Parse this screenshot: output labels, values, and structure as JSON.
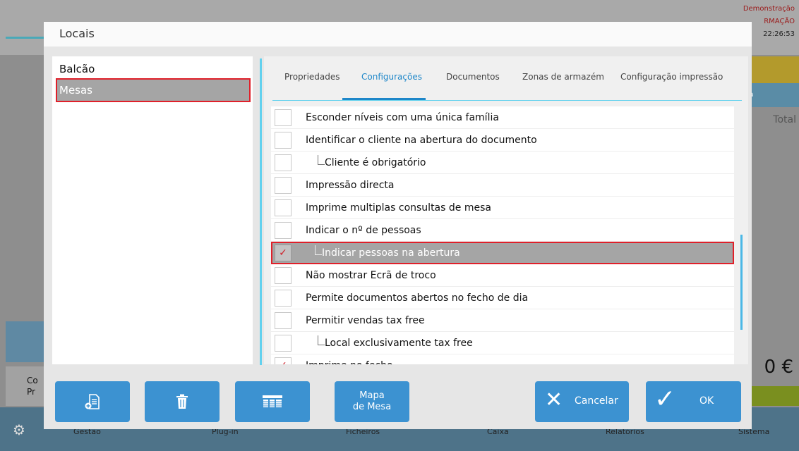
{
  "background": {
    "status": "Demonstração",
    "mode": "RMAÇÃO",
    "time": "22:26:53",
    "side_tab": "sa",
    "total_label": "Total",
    "amount": "0 €",
    "left_button": "Co\nPr",
    "bottom_labels": [
      "Gestão",
      "Plug-in",
      "Ficheiros",
      "Caixa",
      "Relatórios",
      "Sistema"
    ]
  },
  "dialog": {
    "title": "Locais",
    "locations": [
      {
        "label": "Balcão",
        "selected": false
      },
      {
        "label": "Mesas",
        "selected": true
      }
    ],
    "tabs": [
      {
        "label": "Propriedades",
        "active": false
      },
      {
        "label": "Configurações",
        "active": true
      },
      {
        "label": "Documentos",
        "active": false
      },
      {
        "label": "Zonas de armazém",
        "active": false
      },
      {
        "label": "Configuração impressão",
        "active": false
      }
    ],
    "settings": [
      {
        "label": "Esconder níveis com uma única família",
        "checked": false,
        "child": false
      },
      {
        "label": "Identificar o cliente na abertura do documento",
        "checked": false,
        "child": false
      },
      {
        "label": "Cliente é obrigatório",
        "checked": false,
        "child": true
      },
      {
        "label": "Impressão directa",
        "checked": false,
        "child": false
      },
      {
        "label": "Imprime multiplas consultas de mesa",
        "checked": false,
        "child": false
      },
      {
        "label": "Indicar o nº de pessoas",
        "checked": false,
        "child": false
      },
      {
        "label": "Indicar pessoas na abertura",
        "checked": true,
        "child": true,
        "selected": true
      },
      {
        "label": "Não mostrar Ecrã de troco",
        "checked": false,
        "child": false
      },
      {
        "label": "Permite documentos abertos no fecho de dia",
        "checked": false,
        "child": false
      },
      {
        "label": "Permitir vendas tax free",
        "checked": false,
        "child": false
      },
      {
        "label": "Local exclusivamente tax free",
        "checked": false,
        "child": true
      },
      {
        "label": "Imprime no fecho",
        "checked": true,
        "child": false
      }
    ],
    "check_mark": "✓",
    "footer": {
      "new_icon": "new-document-icon",
      "delete_icon": "trash-icon",
      "layout_icon": "tables-grid-icon",
      "map_label": "Mapa\nde Mesa",
      "cancel_label": "Cancelar",
      "ok_label": "OK"
    }
  }
}
